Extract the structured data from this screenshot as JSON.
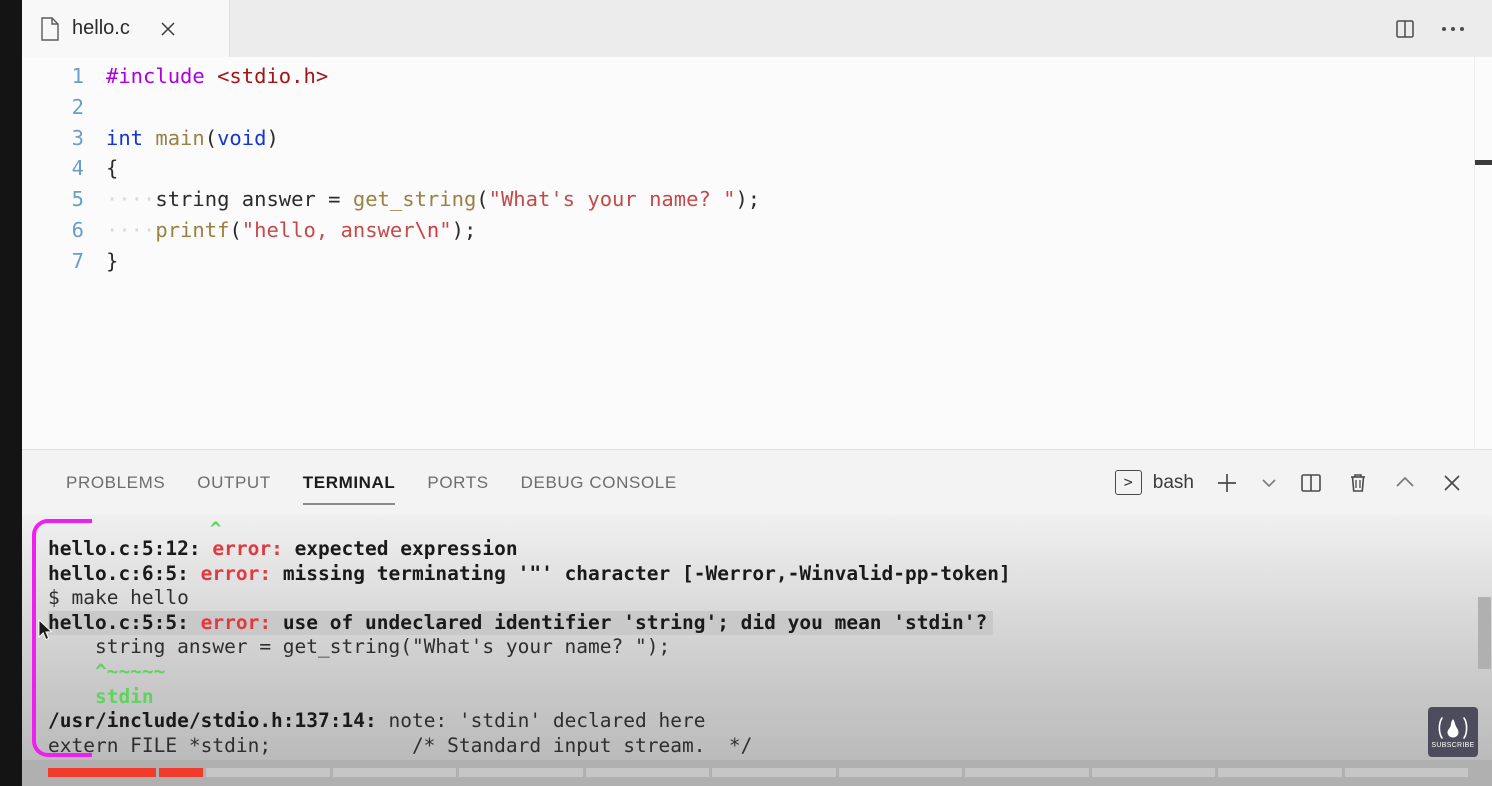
{
  "window": {
    "tab": {
      "label": "hello.c",
      "file_icon": "file-icon",
      "close_icon": "close-icon"
    },
    "actions": {
      "split_editor": "split-editor-icon",
      "more": "more-actions-icon"
    }
  },
  "editor": {
    "lines": [
      {
        "number": "1",
        "indent": "",
        "tokens": [
          {
            "text": "#include",
            "cls": "t-pre"
          },
          {
            "text": " ",
            "cls": "t-pl"
          },
          {
            "text": "<stdio.h>",
            "cls": "t-hdr"
          }
        ]
      },
      {
        "number": "2",
        "indent": "",
        "tokens": []
      },
      {
        "number": "3",
        "indent": "",
        "tokens": [
          {
            "text": "int",
            "cls": "t-kw"
          },
          {
            "text": " ",
            "cls": "t-pl"
          },
          {
            "text": "main",
            "cls": "t-fn"
          },
          {
            "text": "(",
            "cls": "t-pl"
          },
          {
            "text": "void",
            "cls": "t-kw"
          },
          {
            "text": ")",
            "cls": "t-pl"
          }
        ]
      },
      {
        "number": "4",
        "indent": "",
        "tokens": [
          {
            "text": "{",
            "cls": "t-pl"
          }
        ]
      },
      {
        "number": "5",
        "indent": "····",
        "tokens": [
          {
            "text": "string answer = ",
            "cls": "t-pl"
          },
          {
            "text": "get_string",
            "cls": "t-fn"
          },
          {
            "text": "(",
            "cls": "t-pl"
          },
          {
            "text": "\"What's your name? \"",
            "cls": "t-str"
          },
          {
            "text": ");",
            "cls": "t-pl"
          }
        ]
      },
      {
        "number": "6",
        "indent": "····",
        "tokens": [
          {
            "text": "printf",
            "cls": "t-fn"
          },
          {
            "text": "(",
            "cls": "t-pl"
          },
          {
            "text": "\"hello, answer",
            "cls": "t-str"
          },
          {
            "text": "\\n",
            "cls": "t-esc"
          },
          {
            "text": "\"",
            "cls": "t-str"
          },
          {
            "text": ");",
            "cls": "t-pl"
          }
        ]
      },
      {
        "number": "7",
        "indent": "",
        "tokens": [
          {
            "text": "}",
            "cls": "t-pl"
          }
        ]
      }
    ]
  },
  "panel": {
    "tabs": [
      {
        "label": "PROBLEMS",
        "active": false
      },
      {
        "label": "OUTPUT",
        "active": false
      },
      {
        "label": "TERMINAL",
        "active": true
      },
      {
        "label": "PORTS",
        "active": false
      },
      {
        "label": "DEBUG CONSOLE",
        "active": false
      }
    ],
    "shell": {
      "prompt_glyph": ">",
      "name": "bash"
    },
    "actions": [
      {
        "name": "new-terminal-icon",
        "glyph": "+"
      },
      {
        "name": "terminal-dropdown-icon",
        "glyph": "chevron-down"
      },
      {
        "name": "split-terminal-icon",
        "glyph": "split"
      },
      {
        "name": "kill-terminal-icon",
        "glyph": "trash"
      },
      {
        "name": "maximize-panel-icon",
        "glyph": "chevron-up"
      },
      {
        "name": "close-panel-icon",
        "glyph": "x"
      }
    ]
  },
  "terminal": {
    "top_caret": "^",
    "bottom_caret": "^",
    "lines": [
      {
        "highlight": false,
        "parts": [
          {
            "text": "hello.c:5:12: ",
            "cls": "c-bold"
          },
          {
            "text": "error: ",
            "cls": "c-err"
          },
          {
            "text": "expected expression",
            "cls": "c-bold"
          }
        ]
      },
      {
        "highlight": false,
        "parts": [
          {
            "text": "hello.c:6:5: ",
            "cls": "c-bold"
          },
          {
            "text": "error: ",
            "cls": "c-err"
          },
          {
            "text": "missing terminating '\"' character [-Werror,-Winvalid-pp-token]",
            "cls": "c-bold"
          }
        ]
      },
      {
        "highlight": false,
        "parts": [
          {
            "text": "$ make hello",
            "cls": "c-norm"
          }
        ]
      },
      {
        "highlight": true,
        "parts": [
          {
            "text": "hello.c:5:5: ",
            "cls": "c-bold"
          },
          {
            "text": "error: ",
            "cls": "c-err"
          },
          {
            "text": "use of undeclared identifier 'string'; did you mean 'stdin'?",
            "cls": "c-bold"
          }
        ]
      },
      {
        "highlight": false,
        "parts": [
          {
            "text": "    string answer = get_string(\"What's your name? \");",
            "cls": "c-norm"
          }
        ]
      },
      {
        "highlight": false,
        "parts": [
          {
            "text": "    ^~~~~~",
            "cls": "c-grn"
          }
        ]
      },
      {
        "highlight": false,
        "parts": [
          {
            "text": "    stdin",
            "cls": "c-grn"
          }
        ]
      },
      {
        "highlight": false,
        "parts": [
          {
            "text": "/usr/include/stdio.h:137:14: ",
            "cls": "c-bold"
          },
          {
            "text": "note: 'stdin' declared here",
            "cls": "c-norm"
          }
        ]
      },
      {
        "highlight": false,
        "parts": [
          {
            "text": "extern FILE *stdin;            /* Standard input stream.  */",
            "cls": "c-norm"
          }
        ]
      }
    ]
  },
  "overlay": {
    "annotation": "magenta-bracket-annotation",
    "cursor": "mouse-cursor",
    "subscribe_badge": {
      "label": "SUBSCRIBE",
      "icon": "flame-icon",
      "bg": "#4c4c5c"
    }
  },
  "colors": {
    "editor_bg": "#fbfbfb",
    "tabbar_bg": "#ececec",
    "panel_bg": "#f3f3f3",
    "error_red": "#e2383f",
    "suggest_green": "#5fd35f",
    "annotation_magenta": "#f01ef0",
    "scrollbar_red": "#f03b2d"
  }
}
